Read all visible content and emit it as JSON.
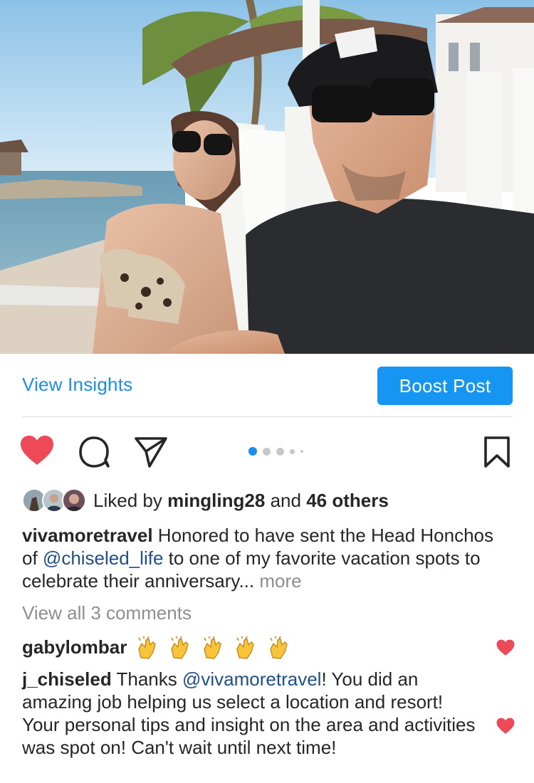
{
  "post": {
    "insights_label": "View Insights",
    "boost_label": "Boost Post",
    "carousel": {
      "count": 5,
      "active": 1
    },
    "likes": {
      "prefix": "Liked by",
      "user": "mingling28",
      "and_word": "and",
      "others": "46 others"
    },
    "caption": {
      "username": "vivamoretravel",
      "text_1": "Honored to have sent the Head Honchos of",
      "mention": "@chiseled_life",
      "text_2": "to one of my favorite vacation spots to celebrate their anniversary...",
      "more": "more"
    },
    "view_all_comments": "View all 3 comments",
    "comments": [
      {
        "username": "gabylombar",
        "emoji": "👏👏👏👏👏"
      },
      {
        "username": "j_chiseled",
        "text_1": "Thanks",
        "mention": "@vivamoretravel",
        "text_2": "! You did an amazing job helping us select a location and resort! Your personal tips and insight on the area and activities was spot on! Can't wait until next time!"
      }
    ]
  },
  "colors": {
    "accent": "#1795f2",
    "link": "#1a8ef0",
    "mention": "#1f4e8c",
    "liked_heart": "#ed4956",
    "muted": "#8e8e8e"
  },
  "icons": {
    "like": "heart-filled-icon",
    "comment": "comment-bubble-icon",
    "share": "paper-plane-icon",
    "save": "bookmark-icon"
  }
}
